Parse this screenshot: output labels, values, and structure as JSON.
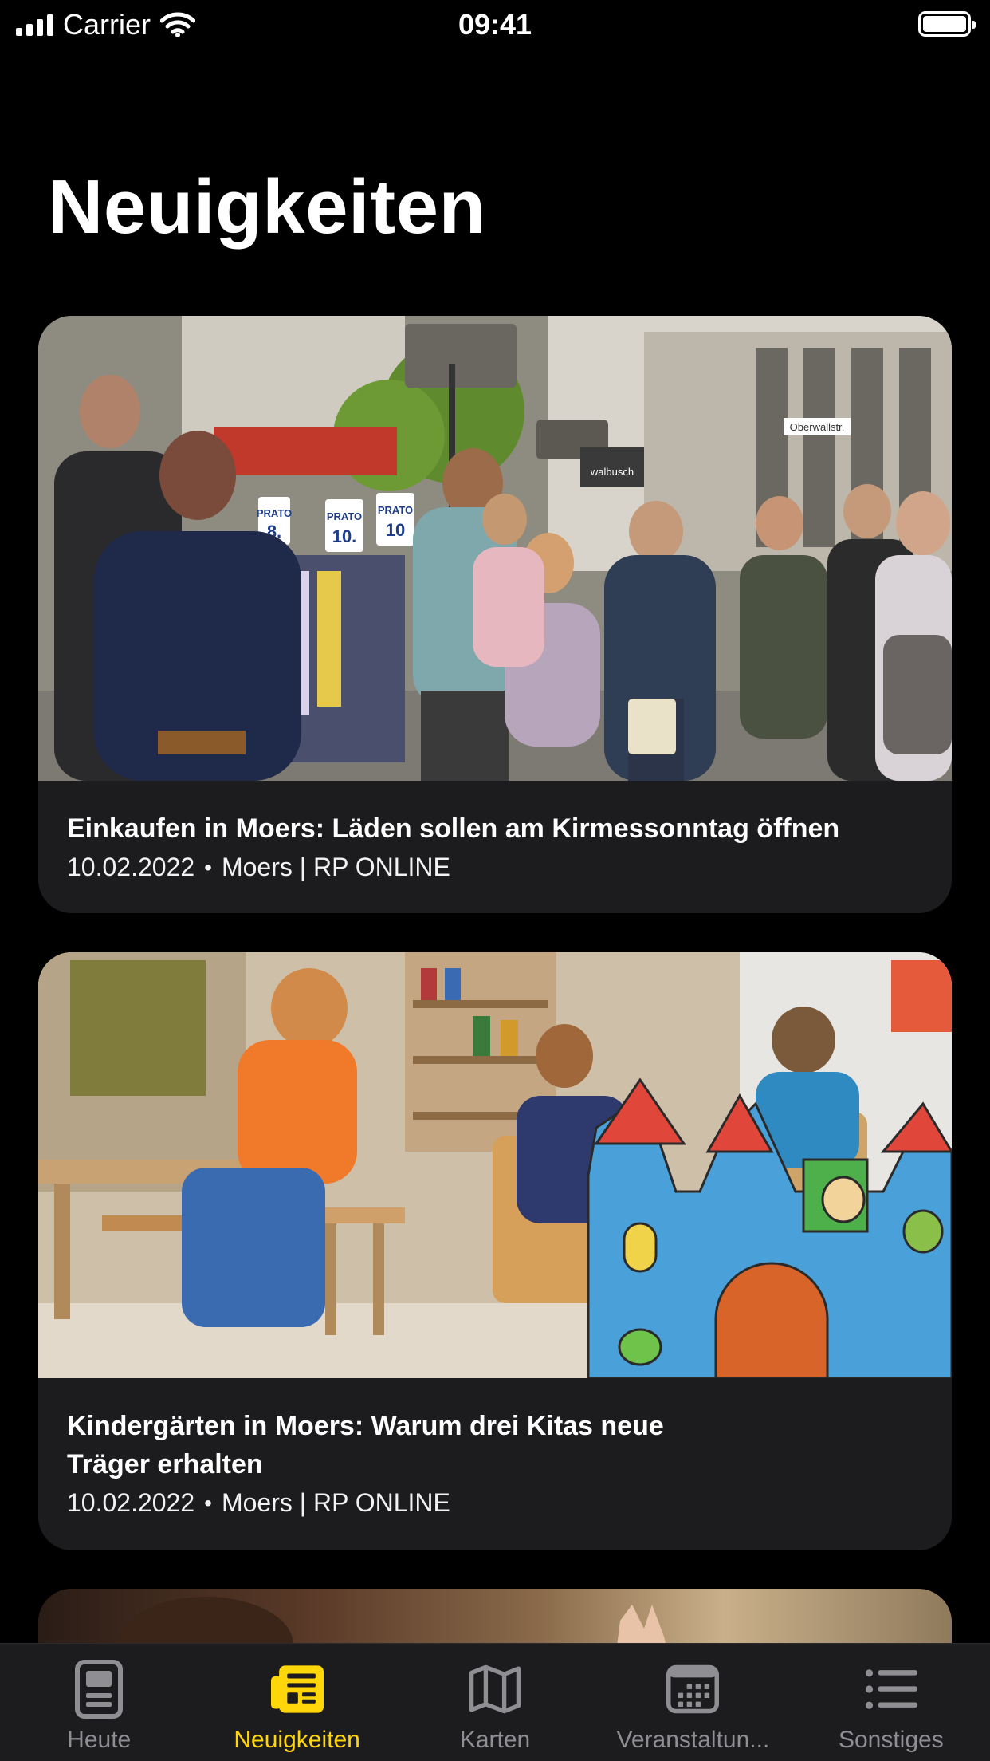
{
  "status_bar": {
    "carrier": "Carrier",
    "time": "09:41"
  },
  "page": {
    "title": "Neuigkeiten"
  },
  "articles": [
    {
      "title": "Einkaufen in Moers: Läden sollen am Kirmessonntag öffnen",
      "date": "10.02.2022",
      "separator": "•",
      "source": "Moers | RP ONLINE",
      "image_signs": [
        "PRATO",
        "8.",
        "PRATO",
        "10.",
        "PRATO",
        "10",
        "walbusch",
        "Oberwallstr."
      ]
    },
    {
      "title_line1": "Kindergärten in Moers: Warum drei Kitas neue",
      "title_line2": "Träger erhalten",
      "date": "10.02.2022",
      "separator": "•",
      "source": "Moers | RP ONLINE"
    }
  ],
  "tab_bar": {
    "active_color": "#ffd60a",
    "inactive_color": "#8e8e93",
    "tabs": [
      {
        "label": "Heute",
        "icon": "phone-icon",
        "active": false
      },
      {
        "label": "Neuigkeiten",
        "icon": "newspaper-icon",
        "active": true
      },
      {
        "label": "Karten",
        "icon": "map-icon",
        "active": false
      },
      {
        "label": "Veranstaltun...",
        "icon": "calendar-icon",
        "active": false
      },
      {
        "label": "Sonstiges",
        "icon": "list-icon",
        "active": false
      }
    ]
  }
}
